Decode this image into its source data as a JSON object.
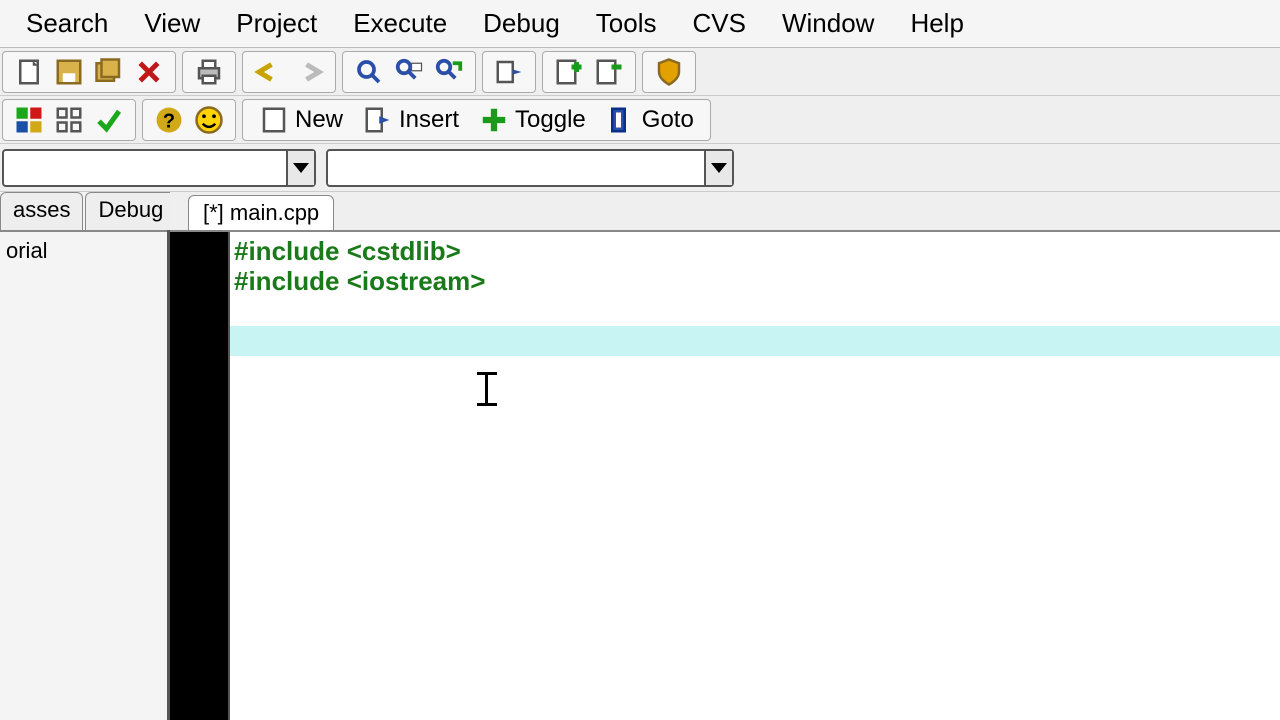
{
  "menu": {
    "search": "Search",
    "view": "View",
    "project": "Project",
    "execute": "Execute",
    "debug": "Debug",
    "tools": "Tools",
    "cvs": "CVS",
    "window": "Window",
    "help": "Help"
  },
  "toolbar2": {
    "new": "New",
    "insert": "Insert",
    "toggle": "Toggle",
    "goto": "Goto"
  },
  "side_tabs": {
    "classes": "asses",
    "debug": "Debug"
  },
  "side_content": "orial",
  "editor_tab": "[*] main.cpp",
  "code": {
    "l1": "#include <cstdlib>",
    "l2": "#include <iostream>",
    "l3": "",
    "l4": ""
  }
}
